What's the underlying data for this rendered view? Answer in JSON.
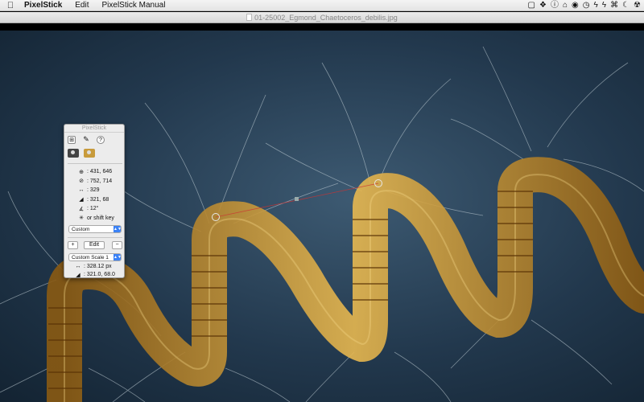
{
  "menubar": {
    "apple_glyph": "",
    "items": [
      "PixelStick",
      "Edit",
      "PixelStick Manual"
    ],
    "status_icons": [
      "clipboard-icon",
      "dropbox-icon",
      "info-icon",
      "home-icon",
      "volume-icon",
      "clock-icon",
      "bolt-icon",
      "bolt-icon",
      "command-icon",
      "moon-icon",
      "nuclear-icon"
    ]
  },
  "window": {
    "title": "01-25002_Egmond_Chaetoceros_debilis.jpg"
  },
  "palette": {
    "title": "PixelStick",
    "help_label": "?",
    "readouts": [
      {
        "icon": "crosshair-start-icon",
        "text": ": 431, 646"
      },
      {
        "icon": "crosshair-end-icon",
        "text": ": 752, 714"
      },
      {
        "icon": "distance-icon",
        "text": ": 329"
      },
      {
        "icon": "delta-icon",
        "text": ": 321, 68"
      },
      {
        "icon": "angle-icon",
        "text": ": 12°"
      },
      {
        "icon": "lock-icon",
        "text": "or shift key"
      }
    ],
    "preset": "Custom",
    "add_label": "+",
    "edit_label": "Edit",
    "remove_label": "−",
    "scale_preset": "Custom Scale 1",
    "scaled_distance": ": 328.12 px",
    "scaled_delta": ": 321.0, 68.0"
  },
  "colors": {
    "background": "#22384d",
    "diatom": "#d9a43a"
  }
}
